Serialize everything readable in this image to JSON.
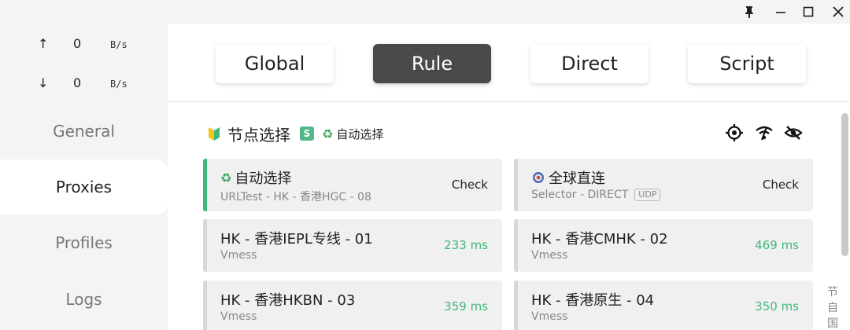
{
  "traffic": {
    "up": {
      "arrow": "↑",
      "value": "0",
      "unit": "B/s"
    },
    "down": {
      "arrow": "↓",
      "value": "0",
      "unit": "B/s"
    }
  },
  "nav": {
    "items": [
      {
        "label": "General",
        "active": false
      },
      {
        "label": "Proxies",
        "active": true
      },
      {
        "label": "Profiles",
        "active": false
      },
      {
        "label": "Logs",
        "active": false
      }
    ]
  },
  "modes": {
    "items": [
      {
        "label": "Global",
        "active": false
      },
      {
        "label": "Rule",
        "active": true
      },
      {
        "label": "Direct",
        "active": false
      },
      {
        "label": "Script",
        "active": false
      }
    ]
  },
  "group": {
    "title": "节点选择",
    "badge": "S",
    "current": "自动选择",
    "icons": [
      "locate-icon",
      "test-latency-icon",
      "hide-icon"
    ]
  },
  "proxies": [
    {
      "name": "自动选择",
      "sub": "URLTest - HK - 香港HGC - 08",
      "right": "Check",
      "selected": true,
      "icon": "recycle-icon"
    },
    {
      "name": "全球直连",
      "sub": "Selector - DIRECT",
      "tag": "UDP",
      "right": "Check",
      "selected": false,
      "icon": "target-icon"
    },
    {
      "name": "HK - 香港IEPL专线 - 01",
      "sub": "Vmess",
      "right": "233 ms",
      "selected": false
    },
    {
      "name": "HK - 香港CMHK - 02",
      "sub": "Vmess",
      "right": "469 ms",
      "selected": false
    },
    {
      "name": "HK - 香港HKBN - 03",
      "sub": "Vmess",
      "right": "359 ms",
      "selected": false
    },
    {
      "name": "HK - 香港原生 - 04",
      "sub": "Vmess",
      "right": "350 ms",
      "selected": false
    }
  ],
  "index": {
    "chars": [
      "节",
      "自",
      "国"
    ]
  },
  "colors": {
    "accent": "#3fb87a",
    "active_mode": "#4a4a4a",
    "sidebar_bg": "#f4f4f4",
    "card_bg": "#f0f0f0"
  }
}
